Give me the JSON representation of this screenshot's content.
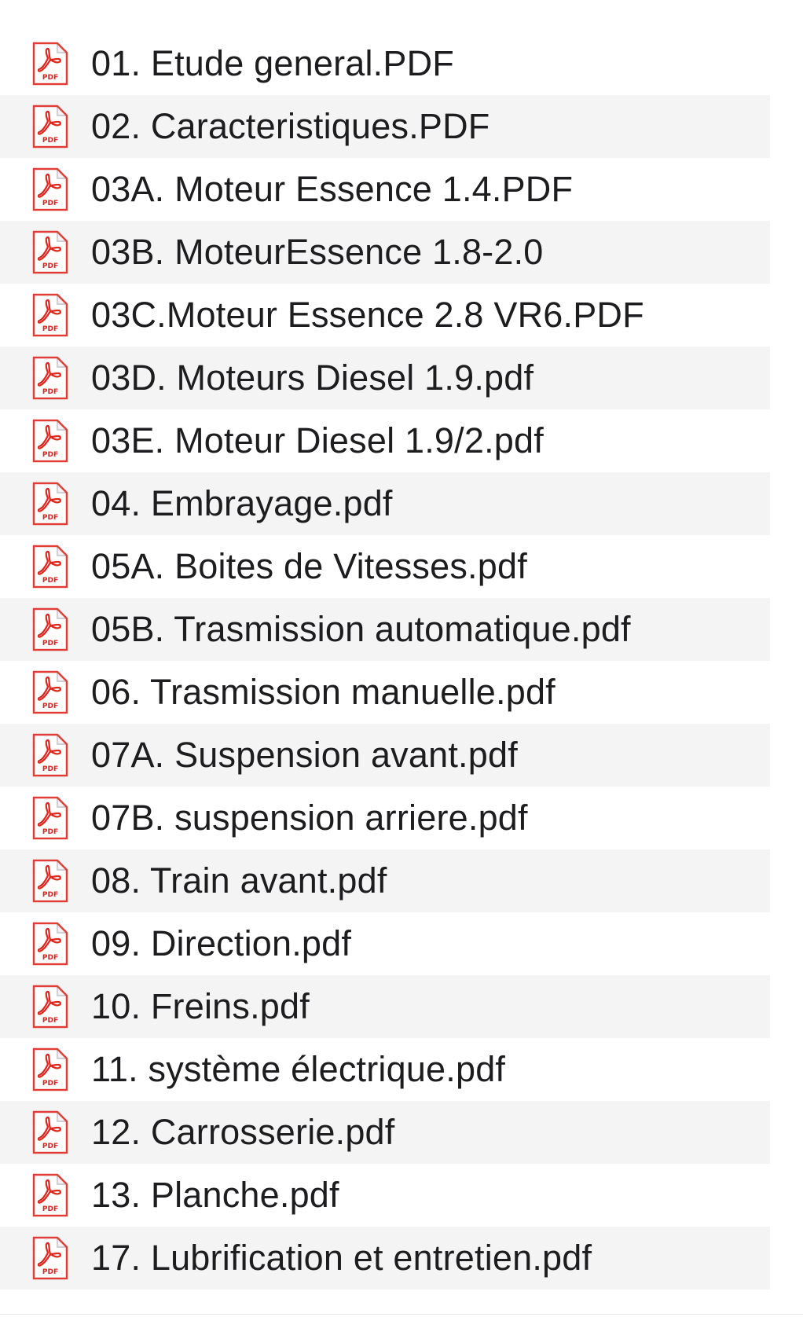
{
  "files": [
    {
      "name": "01. Etude general.PDF",
      "icon": "pdf-file-icon",
      "badge": "PDF"
    },
    {
      "name": "02. Caracteristiques.PDF",
      "icon": "pdf-file-icon",
      "badge": "PDF"
    },
    {
      "name": "03A. Moteur Essence 1.4.PDF",
      "icon": "pdf-file-icon",
      "badge": "PDF"
    },
    {
      "name": "03B. MoteurEssence 1.8-2.0",
      "icon": "pdf-file-icon",
      "badge": "PDF"
    },
    {
      "name": "03C.Moteur Essence 2.8 VR6.PDF",
      "icon": "pdf-file-icon",
      "badge": "PDF"
    },
    {
      "name": "03D. Moteurs Diesel 1.9.pdf",
      "icon": "pdf-file-icon",
      "badge": "PDF"
    },
    {
      "name": "03E. Moteur Diesel 1.9/2.pdf",
      "icon": "pdf-file-icon",
      "badge": "PDF"
    },
    {
      "name": "04. Embrayage.pdf",
      "icon": "pdf-file-icon",
      "badge": "PDF"
    },
    {
      "name": "05A. Boites de Vitesses.pdf",
      "icon": "pdf-file-icon",
      "badge": "PDF"
    },
    {
      "name": "05B. Trasmission automatique.pdf",
      "icon": "pdf-file-icon",
      "badge": "PDF"
    },
    {
      "name": "06. Trasmission manuelle.pdf",
      "icon": "pdf-file-icon",
      "badge": "PDF"
    },
    {
      "name": "07A. Suspension avant.pdf",
      "icon": "pdf-file-icon",
      "badge": "PDF"
    },
    {
      "name": "07B. suspension arriere.pdf",
      "icon": "pdf-file-icon",
      "badge": "PDF"
    },
    {
      "name": "08. Train avant.pdf",
      "icon": "pdf-file-icon",
      "badge": "PDF"
    },
    {
      "name": "09. Direction.pdf",
      "icon": "pdf-file-icon",
      "badge": "PDF"
    },
    {
      "name": "10. Freins.pdf",
      "icon": "pdf-file-icon",
      "badge": "PDF"
    },
    {
      "name": "11. système électrique.pdf",
      "icon": "pdf-file-icon",
      "badge": "PDF"
    },
    {
      "name": "12. Carrosserie.pdf",
      "icon": "pdf-file-icon",
      "badge": "PDF"
    },
    {
      "name": "13. Planche.pdf",
      "icon": "pdf-file-icon",
      "badge": "PDF"
    },
    {
      "name": "17. Lubrification et entretien.pdf",
      "icon": "pdf-file-icon",
      "badge": "PDF"
    }
  ],
  "colors": {
    "row_alt": "#f4f4f5",
    "text": "#1d1d1f",
    "pdf_red": "#e2231a"
  }
}
